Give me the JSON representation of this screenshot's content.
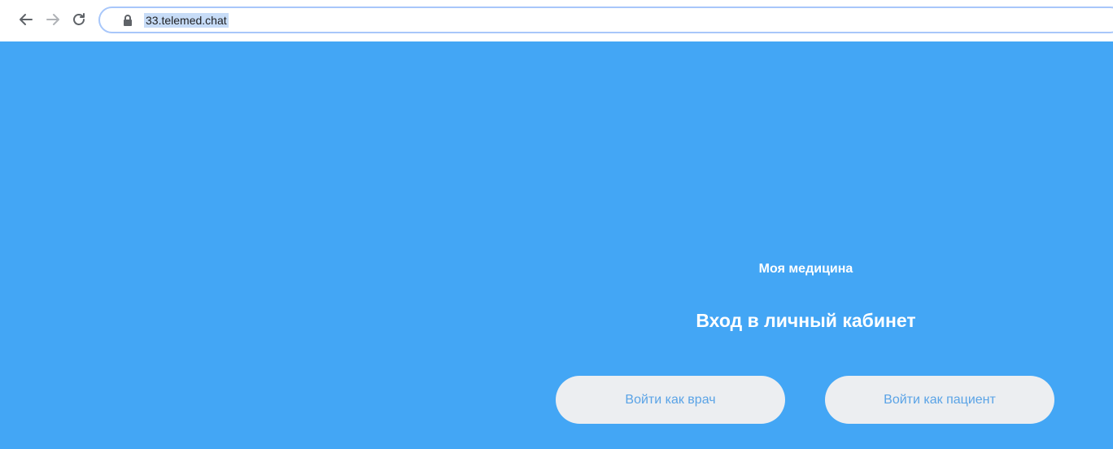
{
  "browser": {
    "url": "33.telemed.chat",
    "icons": {
      "back": "arrow-left-icon",
      "forward": "arrow-right-icon",
      "reload": "reload-icon",
      "security": "lock-icon"
    }
  },
  "page": {
    "background_color": "#43a6f5",
    "brand": "Моя медицина",
    "title": "Вход в личный кабинет",
    "buttons": {
      "doctor_label": "Войти как врач",
      "patient_label": "Войти как пациент"
    }
  }
}
